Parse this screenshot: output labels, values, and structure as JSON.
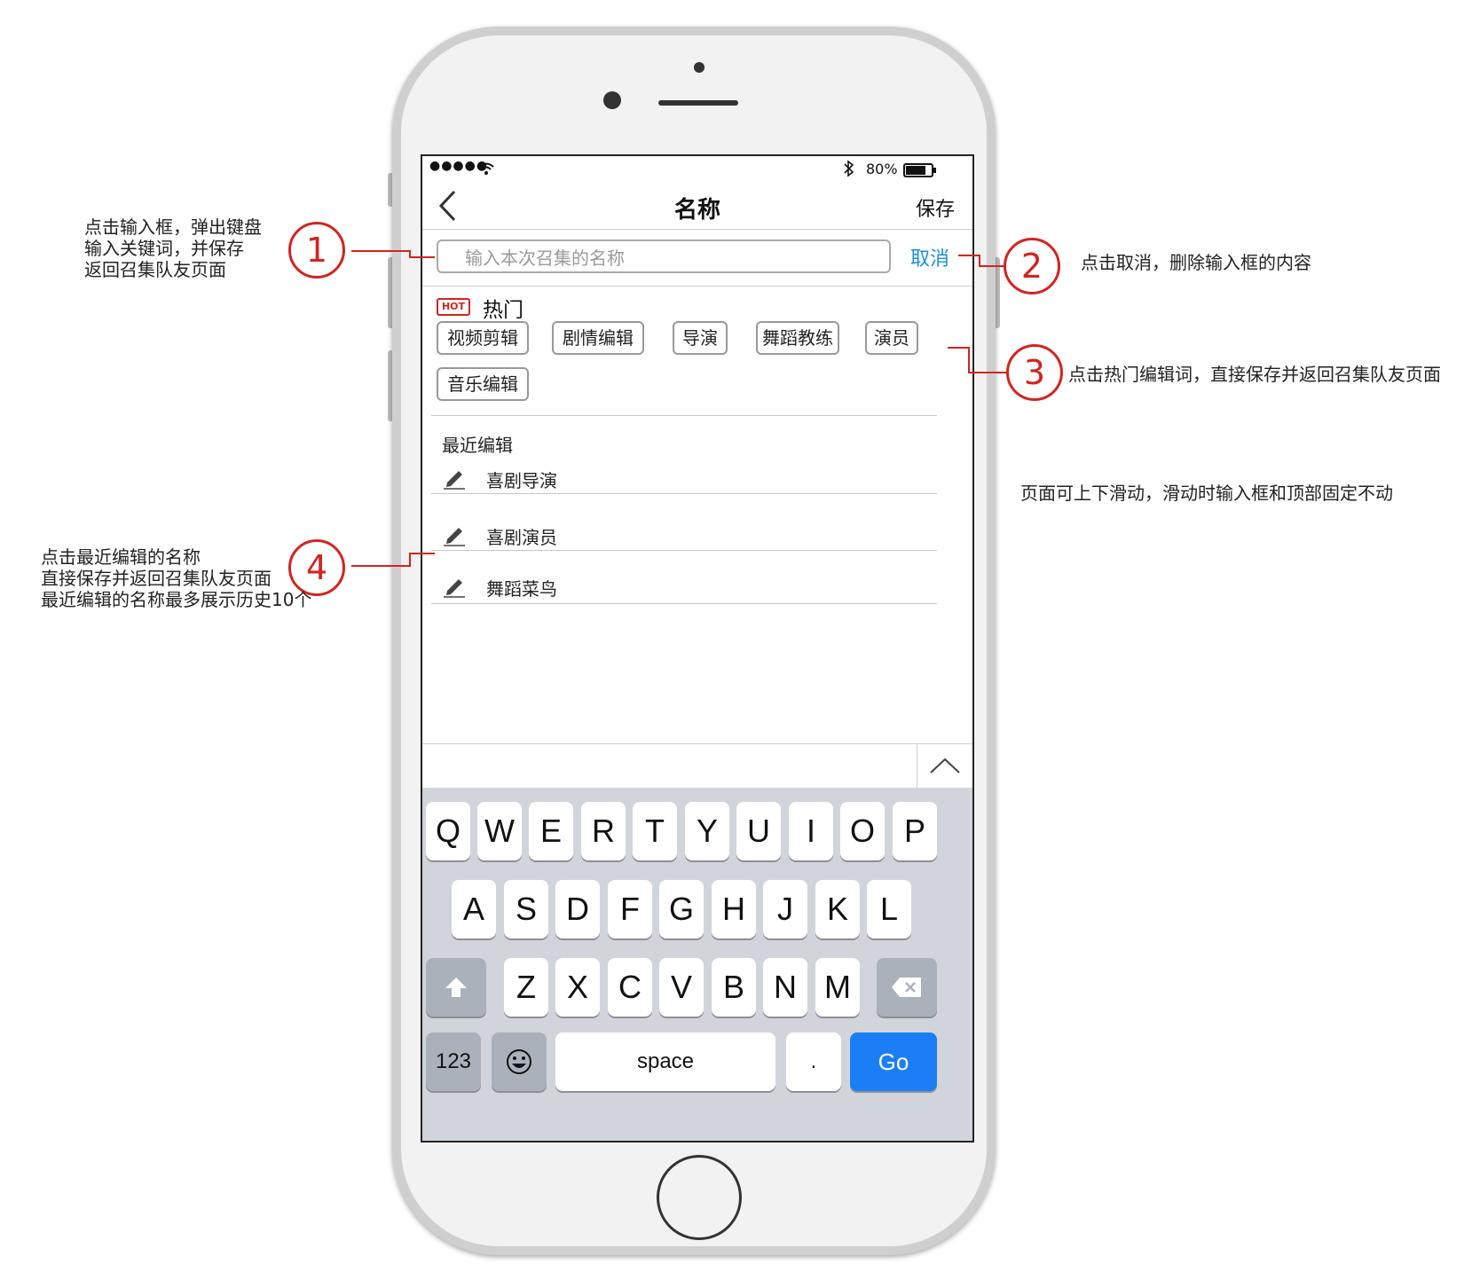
{
  "status_bar": {
    "signal": "●●●●●",
    "battery": "80%"
  },
  "nav": {
    "title": "名称",
    "save_label": "保存"
  },
  "search": {
    "placeholder": "输入本次召集的名称",
    "cancel_label": "取消"
  },
  "hot": {
    "badge": "HOT",
    "title": "热门",
    "tags": [
      "视频剪辑",
      "剧情编辑",
      "导演",
      "舞蹈教练",
      "演员",
      "音乐编辑"
    ]
  },
  "recent": {
    "title": "最近编辑",
    "items": [
      "喜剧导演",
      "喜剧演员",
      "舞蹈菜鸟"
    ]
  },
  "keyboard": {
    "row1": [
      "Q",
      "W",
      "E",
      "R",
      "T",
      "Y",
      "U",
      "I",
      "O",
      "P"
    ],
    "row2": [
      "A",
      "S",
      "D",
      "F",
      "G",
      "H",
      "J",
      "K",
      "L"
    ],
    "row3": [
      "Z",
      "X",
      "C",
      "V",
      "B",
      "N",
      "M"
    ],
    "numbers_label": "123",
    "space_label": "space",
    "period_label": ".",
    "go_label": "Go"
  },
  "annotations": {
    "a1": {
      "number": "1",
      "lines": [
        "点击输入框，弹出键盘",
        "输入关键词，并保存",
        "返回召集队友页面"
      ]
    },
    "a2": {
      "number": "2",
      "text": "点击取消，删除输入框的内容"
    },
    "a3": {
      "number": "3",
      "text": "点击热门编辑词，直接保存并返回召集队友页面"
    },
    "a4": {
      "number": "4",
      "lines": [
        "点击最近编辑的名称",
        "直接保存并返回召集队友页面",
        "最近编辑的名称最多展示历史10个"
      ]
    },
    "scroll_note": "页面可上下滑动，滑动时输入框和顶部固定不动"
  },
  "colors": {
    "annotation_red": "#d3241f",
    "link_blue": "#1a8fd8",
    "go_blue": "#1b7ef6"
  }
}
